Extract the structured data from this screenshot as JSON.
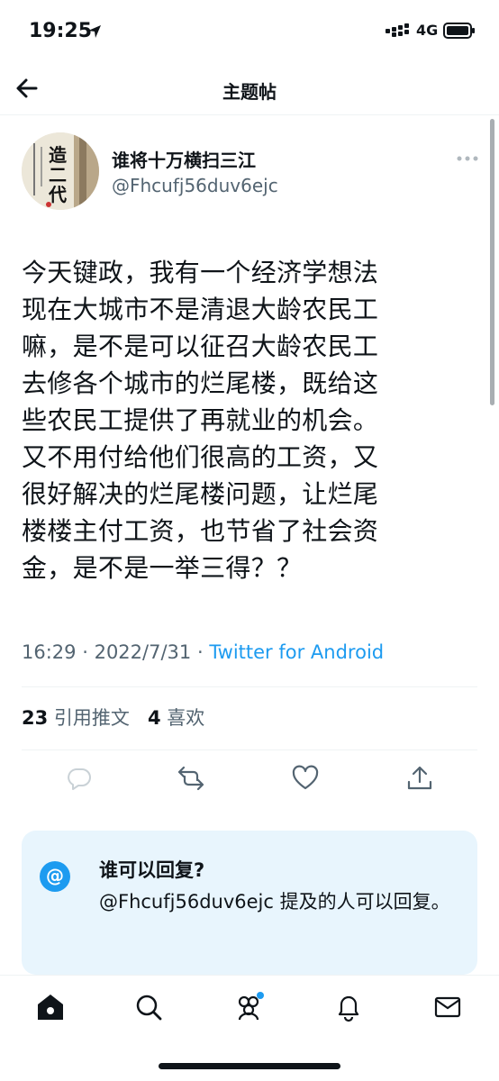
{
  "status_bar": {
    "time": "19:25",
    "network": "4G"
  },
  "header": {
    "title": "主题帖"
  },
  "tweet": {
    "avatar_text": "造二代",
    "display_name": "谁将十万横扫三江",
    "handle": "@Fhcufj56duv6ejc",
    "text": "今天键政，我有一个经济学想法\n现在大城市不是清退大龄农民工\n嘛，是不是可以征召大龄农民工\n去修各个城市的烂尾楼，既给这\n些农民工提供了再就业的机会。\n又不用付给他们很高的工资，又\n很好解决的烂尾楼问题，让烂尾\n楼楼主付工资，也节省了社会资\n金，是不是一举三得？？",
    "time": "16:29",
    "date": "2022/7/31",
    "source": "Twitter for Android",
    "quote_count": "23",
    "quote_label": "引用推文",
    "like_count": "4",
    "like_label": "喜欢"
  },
  "reply_box": {
    "at_symbol": "@",
    "title": "谁可以回复?",
    "description": "@Fhcufj56duv6ejc 提及的人可以回复。"
  },
  "colors": {
    "accent": "#1d9bf0",
    "reply_box_bg": "#e8f5fd",
    "secondary_text": "#536471"
  }
}
